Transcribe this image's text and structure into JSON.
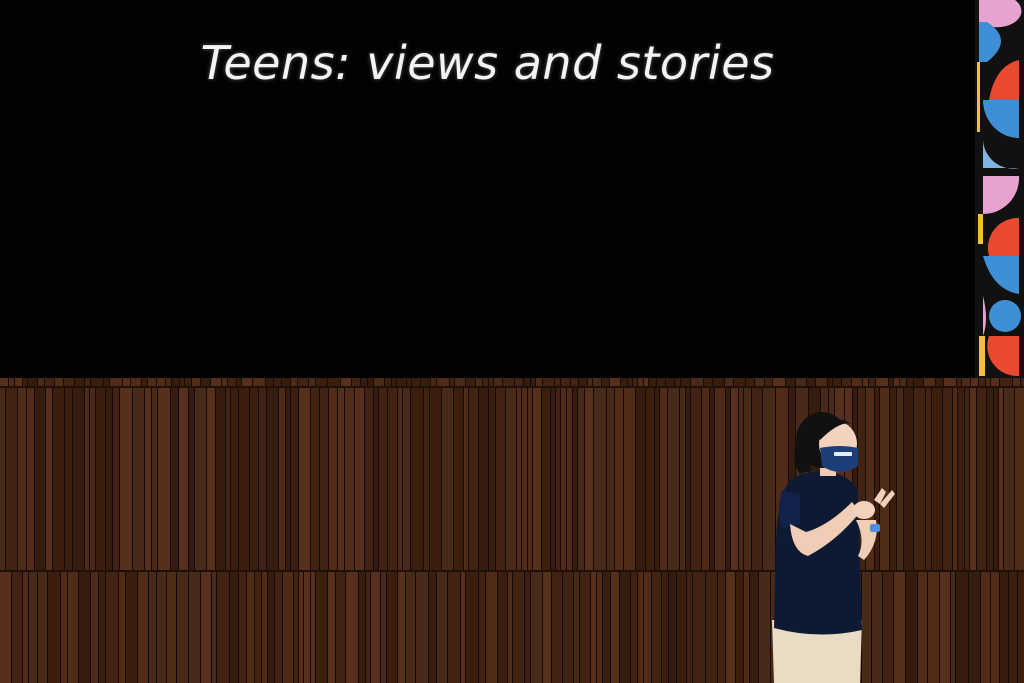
{
  "slide": {
    "title": "Teens: views and stories"
  },
  "colors": {
    "screen": "#020202",
    "title_text": "#f4f4f4",
    "wall_wood": "#4a2716",
    "panel_blue": "#3f8fd6",
    "panel_pink": "#e7a3cf",
    "panel_red": "#e8492f",
    "panel_yellow": "#f2c230",
    "shirt": "#0e1a34",
    "mask": "#1d3f78",
    "trousers": "#e8dcc4"
  },
  "icons": {
    "mask_logo": "mask-logo-icon"
  }
}
